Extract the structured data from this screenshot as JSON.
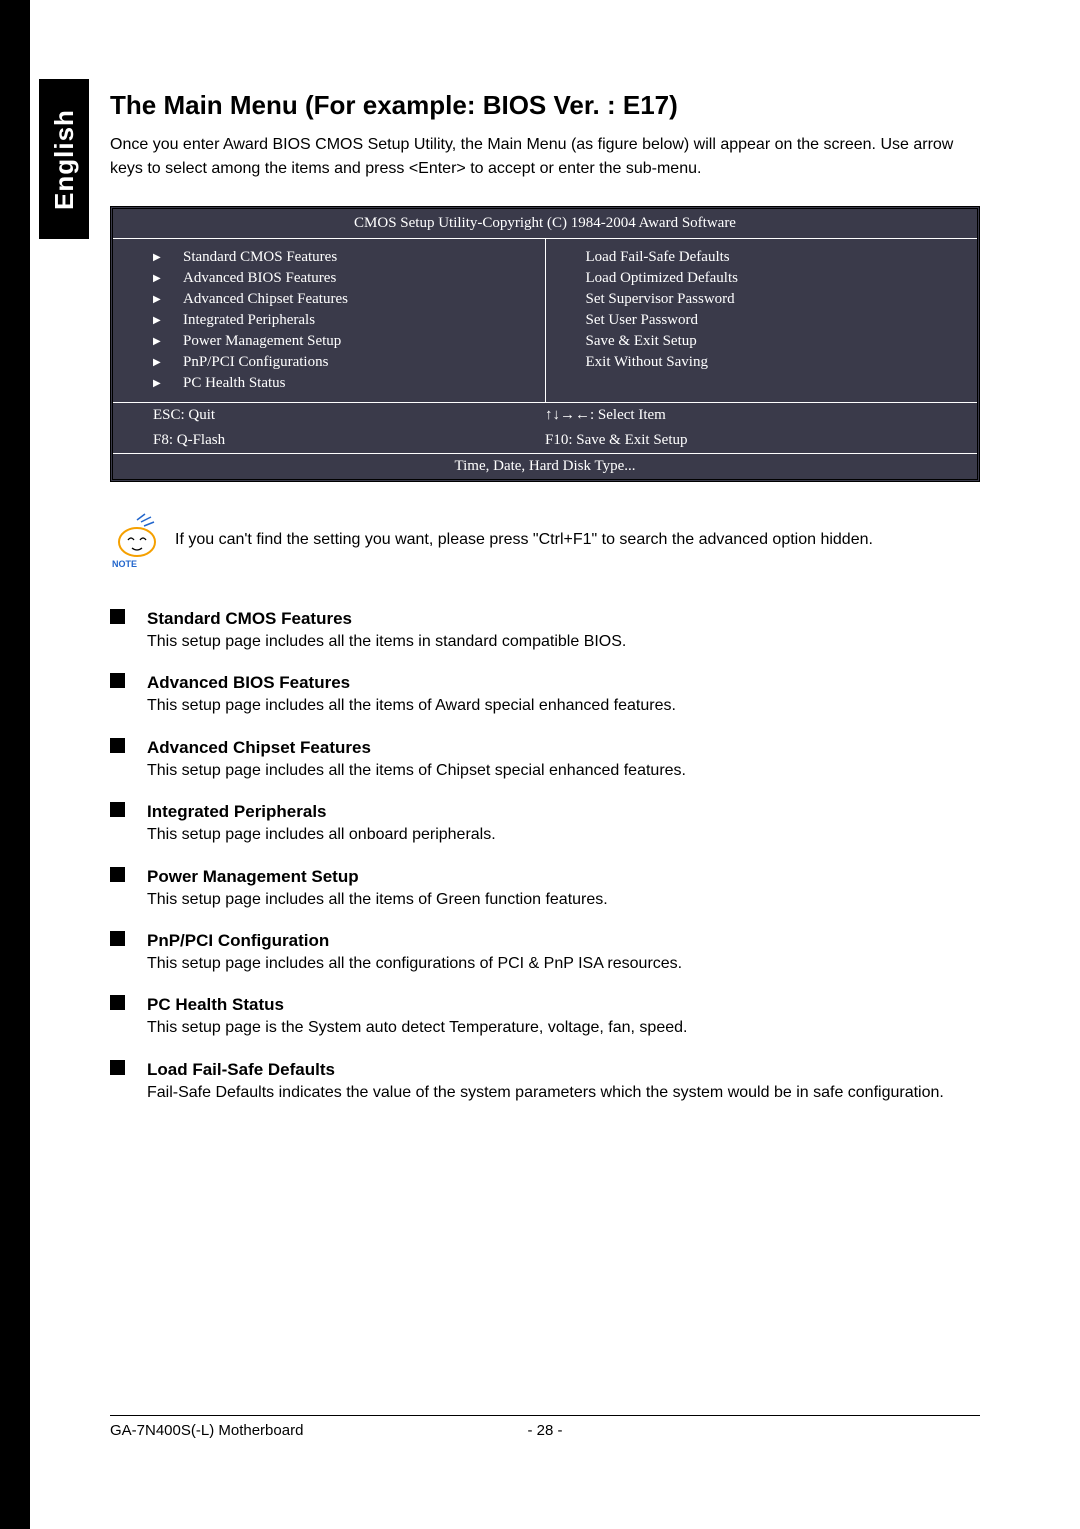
{
  "language": "English",
  "heading": "The Main Menu (For example: BIOS Ver. : E17)",
  "intro_line1": "Once you enter Award BIOS CMOS Setup Utility, the Main Menu (as figure below) will appear on the screen.",
  "intro_line2": "Use arrow keys to select among the items and press <Enter> to accept or enter the sub-menu.",
  "bios": {
    "title": "CMOS Setup Utility-Copyright (C) 1984-2004 Award Software",
    "left": [
      "Standard CMOS Features",
      "Advanced BIOS Features",
      "Advanced Chipset Features",
      "Integrated Peripherals",
      "Power Management Setup",
      "PnP/PCI Configurations",
      "PC Health Status"
    ],
    "right": [
      "Load Fail-Safe Defaults",
      "Load Optimized Defaults",
      "Set Supervisor Password",
      "Set User Password",
      "Save & Exit Setup",
      "Exit Without Saving"
    ],
    "footer": {
      "esc": "ESC: Quit",
      "select": "↑↓→←: Select Item",
      "f8": "F8: Q-Flash",
      "f10": "F10: Save & Exit Setup",
      "helpline": "Time, Date, Hard Disk Type..."
    }
  },
  "note": {
    "label": "NOTE",
    "text": "If you can't find the setting you want, please press \"Ctrl+F1\" to search the advanced option hidden."
  },
  "sections": [
    {
      "title": "Standard CMOS Features",
      "desc": "This setup page includes all the items in standard compatible BIOS."
    },
    {
      "title": "Advanced BIOS Features",
      "desc": "This setup page includes all the items of Award special enhanced features."
    },
    {
      "title": "Advanced Chipset Features",
      "desc": "This setup page includes all the items of Chipset special enhanced features."
    },
    {
      "title": "Integrated Peripherals",
      "desc": "This setup page includes all onboard peripherals."
    },
    {
      "title": "Power Management Setup",
      "desc": "This setup page includes all the items of Green function features."
    },
    {
      "title": "PnP/PCI Configuration",
      "desc": "This setup page includes all the configurations of PCI & PnP ISA resources."
    },
    {
      "title": "PC Health Status",
      "desc": "This setup page is the System auto detect Temperature, voltage, fan, speed."
    },
    {
      "title": "Load Fail-Safe Defaults",
      "desc": "Fail-Safe Defaults indicates the value of the system parameters which the system would be in safe configuration."
    }
  ],
  "footer": {
    "left": "GA-7N400S(-L) Motherboard",
    "center": "- 28 -"
  }
}
